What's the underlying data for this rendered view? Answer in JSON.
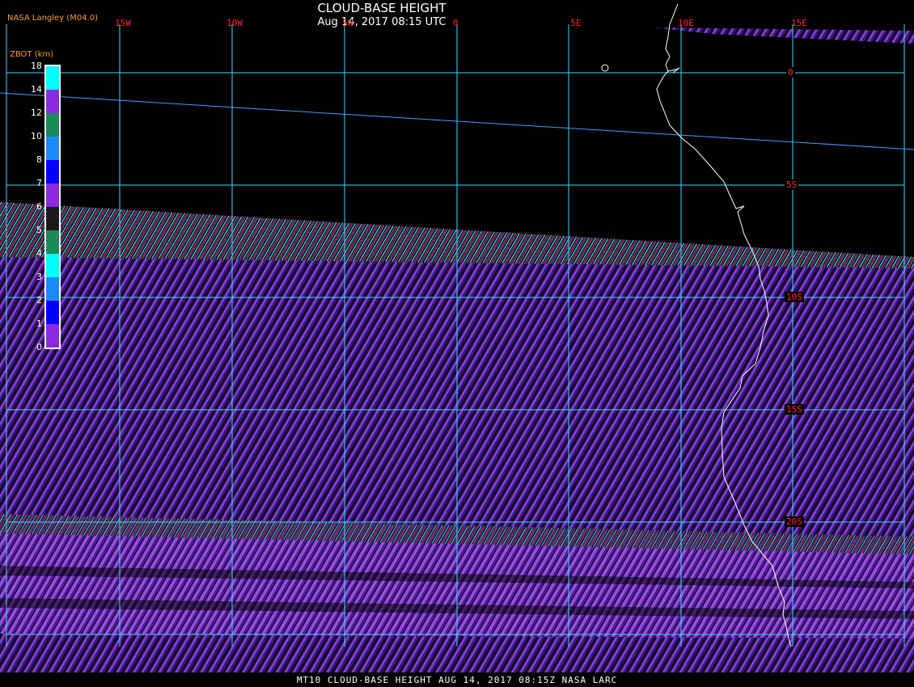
{
  "title": "CLOUD-BASE HEIGHT",
  "subtitle": "Aug 14, 2017 08:15 UTC",
  "source": "NASA Langley (M04.0)",
  "colorbar": {
    "units": "ZBOT (km)",
    "tick_labels": [
      "18",
      "14",
      "12",
      "10",
      "8",
      "7",
      "6",
      "5",
      "4",
      "3",
      "2",
      "1",
      "0"
    ],
    "colors": [
      "#00ffff",
      "#8a2be2",
      "#1a8a5a",
      "#1a8aff",
      "#0000ff",
      "#8a2be2",
      "#1a1a1a",
      "#1a8a5a",
      "#00ffff",
      "#1a8aff",
      "#0000ff",
      "#8a2be2"
    ]
  },
  "grid": {
    "longitudes": [
      "15W",
      "10W",
      "5W",
      "0",
      "5E",
      "10E",
      "15E"
    ],
    "latitudes": [
      "0",
      "5S",
      "10S",
      "15S",
      "20S"
    ],
    "grid_color": "#3fd6ff",
    "label_color": "#ff2a2a"
  },
  "swath_colors": {
    "purple": "#8a3ad8",
    "blue": "#4a3ae8",
    "cyan": "#33c4d8",
    "red": "#b02a2a"
  },
  "footer": "MT10  CLOUD-BASE HEIGHT   AUG 14, 2017 08:15Z   NASA LARC"
}
